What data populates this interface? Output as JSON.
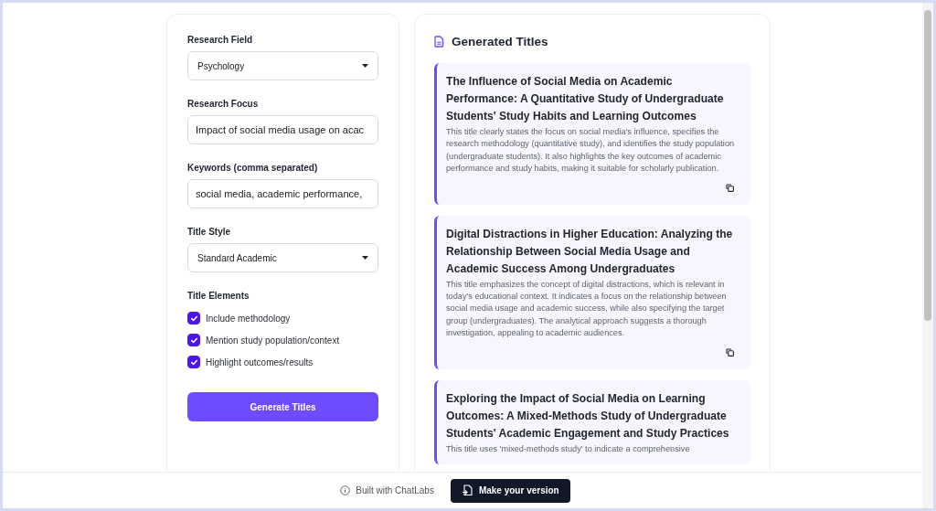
{
  "form": {
    "fields": [
      {
        "kind": "select",
        "label": "Research Field",
        "value": "Psychology"
      },
      {
        "kind": "text",
        "label": "Research Focus",
        "value": "Impact of social media usage on acac"
      },
      {
        "kind": "text",
        "label": "Keywords (comma separated)",
        "value": "social media, academic performance,"
      },
      {
        "kind": "select",
        "label": "Title Style",
        "value": "Standard Academic"
      }
    ],
    "elements_label": "Title Elements",
    "elements": [
      {
        "label": "Include methodology",
        "checked": true
      },
      {
        "label": "Mention study population/context",
        "checked": true
      },
      {
        "label": "Highlight outcomes/results",
        "checked": true
      }
    ],
    "button": "Generate Titles"
  },
  "results": {
    "heading": "Generated Titles",
    "titles": [
      {
        "title": "The Influence of Social Media on Academic Performance: A Quantitative Study of Undergraduate Students' Study Habits and Learning Outcomes",
        "description": "This title clearly states the focus on social media's influence, specifies the research methodology (quantitative study), and identifies the study population (undergraduate students). It also highlights the key outcomes of academic performance and study habits, making it suitable for scholarly publication."
      },
      {
        "title": "Digital Distractions in Higher Education: Analyzing the Relationship Between Social Media Usage and Academic Success Among Undergraduates",
        "description": "This title emphasizes the concept of digital distractions, which is relevant in today's educational context. It indicates a focus on the relationship between social media usage and academic success, while also specifying the target group (undergraduates). The analytical approach suggests a thorough investigation, appealing to academic audiences."
      },
      {
        "title": "Exploring the Impact of Social Media on Learning Outcomes: A Mixed-Methods Study of Undergraduate Students' Academic Engagement and Study Practices",
        "description": "This title uses 'mixed-methods study' to indicate a comprehensive"
      }
    ]
  },
  "footer": {
    "credit": "Built with ChatLabs",
    "button": "Make your version"
  }
}
